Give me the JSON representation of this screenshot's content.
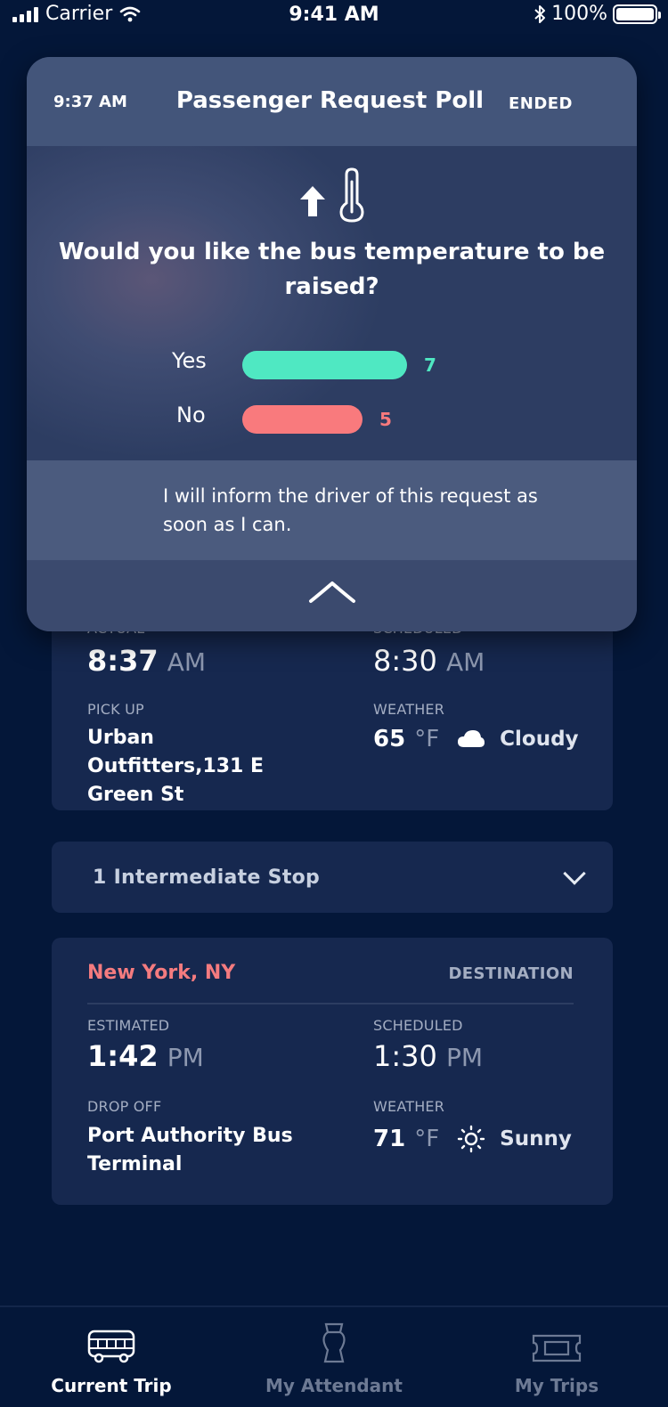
{
  "status_bar": {
    "carrier": "Carrier",
    "time": "9:41 AM",
    "battery": "100%"
  },
  "poll": {
    "time": "9:37 AM",
    "title": "Passenger Request Poll",
    "status": "ENDED",
    "icons": [
      "arrow-up-icon",
      "thermometer-icon"
    ],
    "question": "Would you like the bus temperature to be raised?",
    "options": [
      {
        "label": "Yes",
        "count": "7",
        "votes": 7,
        "color": "#4fe8c2"
      },
      {
        "label": "No",
        "count": "5",
        "votes": 5,
        "color": "#f97a7d"
      }
    ],
    "message": "I will inform the driver of this request as soon as I can."
  },
  "origin": {
    "actual_label": "ACTUAL",
    "actual_time": "8:37",
    "actual_ampm": "AM",
    "scheduled_label": "SCHEDULED",
    "scheduled_time": "8:30",
    "scheduled_ampm": "AM",
    "pickup_label": "PICK UP",
    "pickup_address": "Urban Outfitters,131 E Green St",
    "weather_label": "WEATHER",
    "temp": "65",
    "temp_unit": "°F",
    "condition": "Cloudy",
    "condition_icon": "cloud-icon"
  },
  "intermediate": {
    "label": "1 Intermediate Stop"
  },
  "destination": {
    "city": "New York, NY",
    "tag": "DESTINATION",
    "estimated_label": "ESTIMATED",
    "estimated_time": "1:42",
    "estimated_ampm": "PM",
    "scheduled_label": "SCHEDULED",
    "scheduled_time": "1:30",
    "scheduled_ampm": "PM",
    "dropoff_label": "DROP OFF",
    "dropoff_address": "Port Authority Bus Terminal",
    "weather_label": "WEATHER",
    "temp": "71",
    "temp_unit": "°F",
    "condition": "Sunny",
    "condition_icon": "sun-icon"
  },
  "tabs": [
    {
      "label": "Current Trip",
      "icon": "bus-icon",
      "active": true
    },
    {
      "label": "My Attendant",
      "icon": "attendant-icon",
      "active": false
    },
    {
      "label": "My Trips",
      "icon": "ticket-icon",
      "active": false
    }
  ],
  "colors": {
    "background": "#041739",
    "card": "#16284f",
    "accent_green": "#4fe8c2",
    "accent_red": "#f97a7d",
    "city_red": "#f47b7f"
  }
}
